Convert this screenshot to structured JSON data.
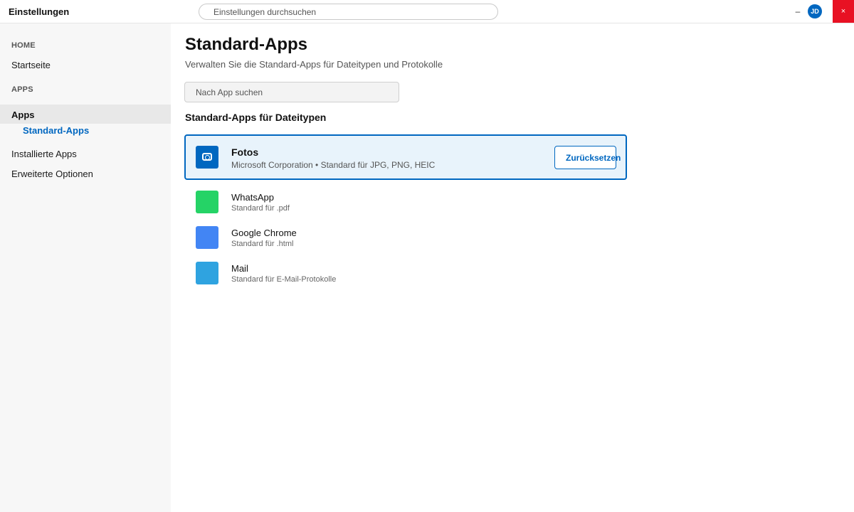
{
  "titlebar": {
    "title": "Einstellungen",
    "search_placeholder": "Einstellungen durchsuchen",
    "minimize_label": "–",
    "avatar_initials": "JD",
    "close_label": "×",
    "close_color": "#e81123",
    "avatar_color": "#0067c0"
  },
  "sidebar": {
    "home_heading": "HOME",
    "home_items": [
      {
        "label": "Startseite"
      }
    ],
    "apps_heading": "APPS",
    "apps_items": [
      {
        "label": "Apps",
        "active": true
      },
      {
        "label": "Standard-Apps",
        "sub": true,
        "selected": true
      },
      {
        "label": "Installierte Apps"
      },
      {
        "label": "Erweiterte Optionen"
      }
    ]
  },
  "main": {
    "title": "Standard-Apps",
    "subtitle": "Verwalten Sie die Standard-Apps für Dateitypen und Protokolle",
    "search_placeholder": "Nach App suchen",
    "section_heading": "Standard-Apps für Dateitypen",
    "selected_app": {
      "name": "Fotos",
      "description": "Microsoft Corporation • Standard für JPG, PNG, HEIC",
      "icon": "camera-icon",
      "icon_color": "#0067c0",
      "action_label": "Zurücksetzen"
    },
    "apps": [
      {
        "name": "WhatsApp",
        "description": "Standard für .pdf",
        "icon_color": "#25d366"
      },
      {
        "name": "Google Chrome",
        "description": "Standard für .html",
        "icon_color": "#4285f4"
      },
      {
        "name": "Mail",
        "description": "Standard für E-Mail-Protokolle",
        "icon_color": "#2fa3e0"
      }
    ]
  },
  "colors": {
    "accent": "#0067c0",
    "sidebar_bg": "#f7f7f7",
    "selected_card_bg": "#e8f3fb"
  }
}
